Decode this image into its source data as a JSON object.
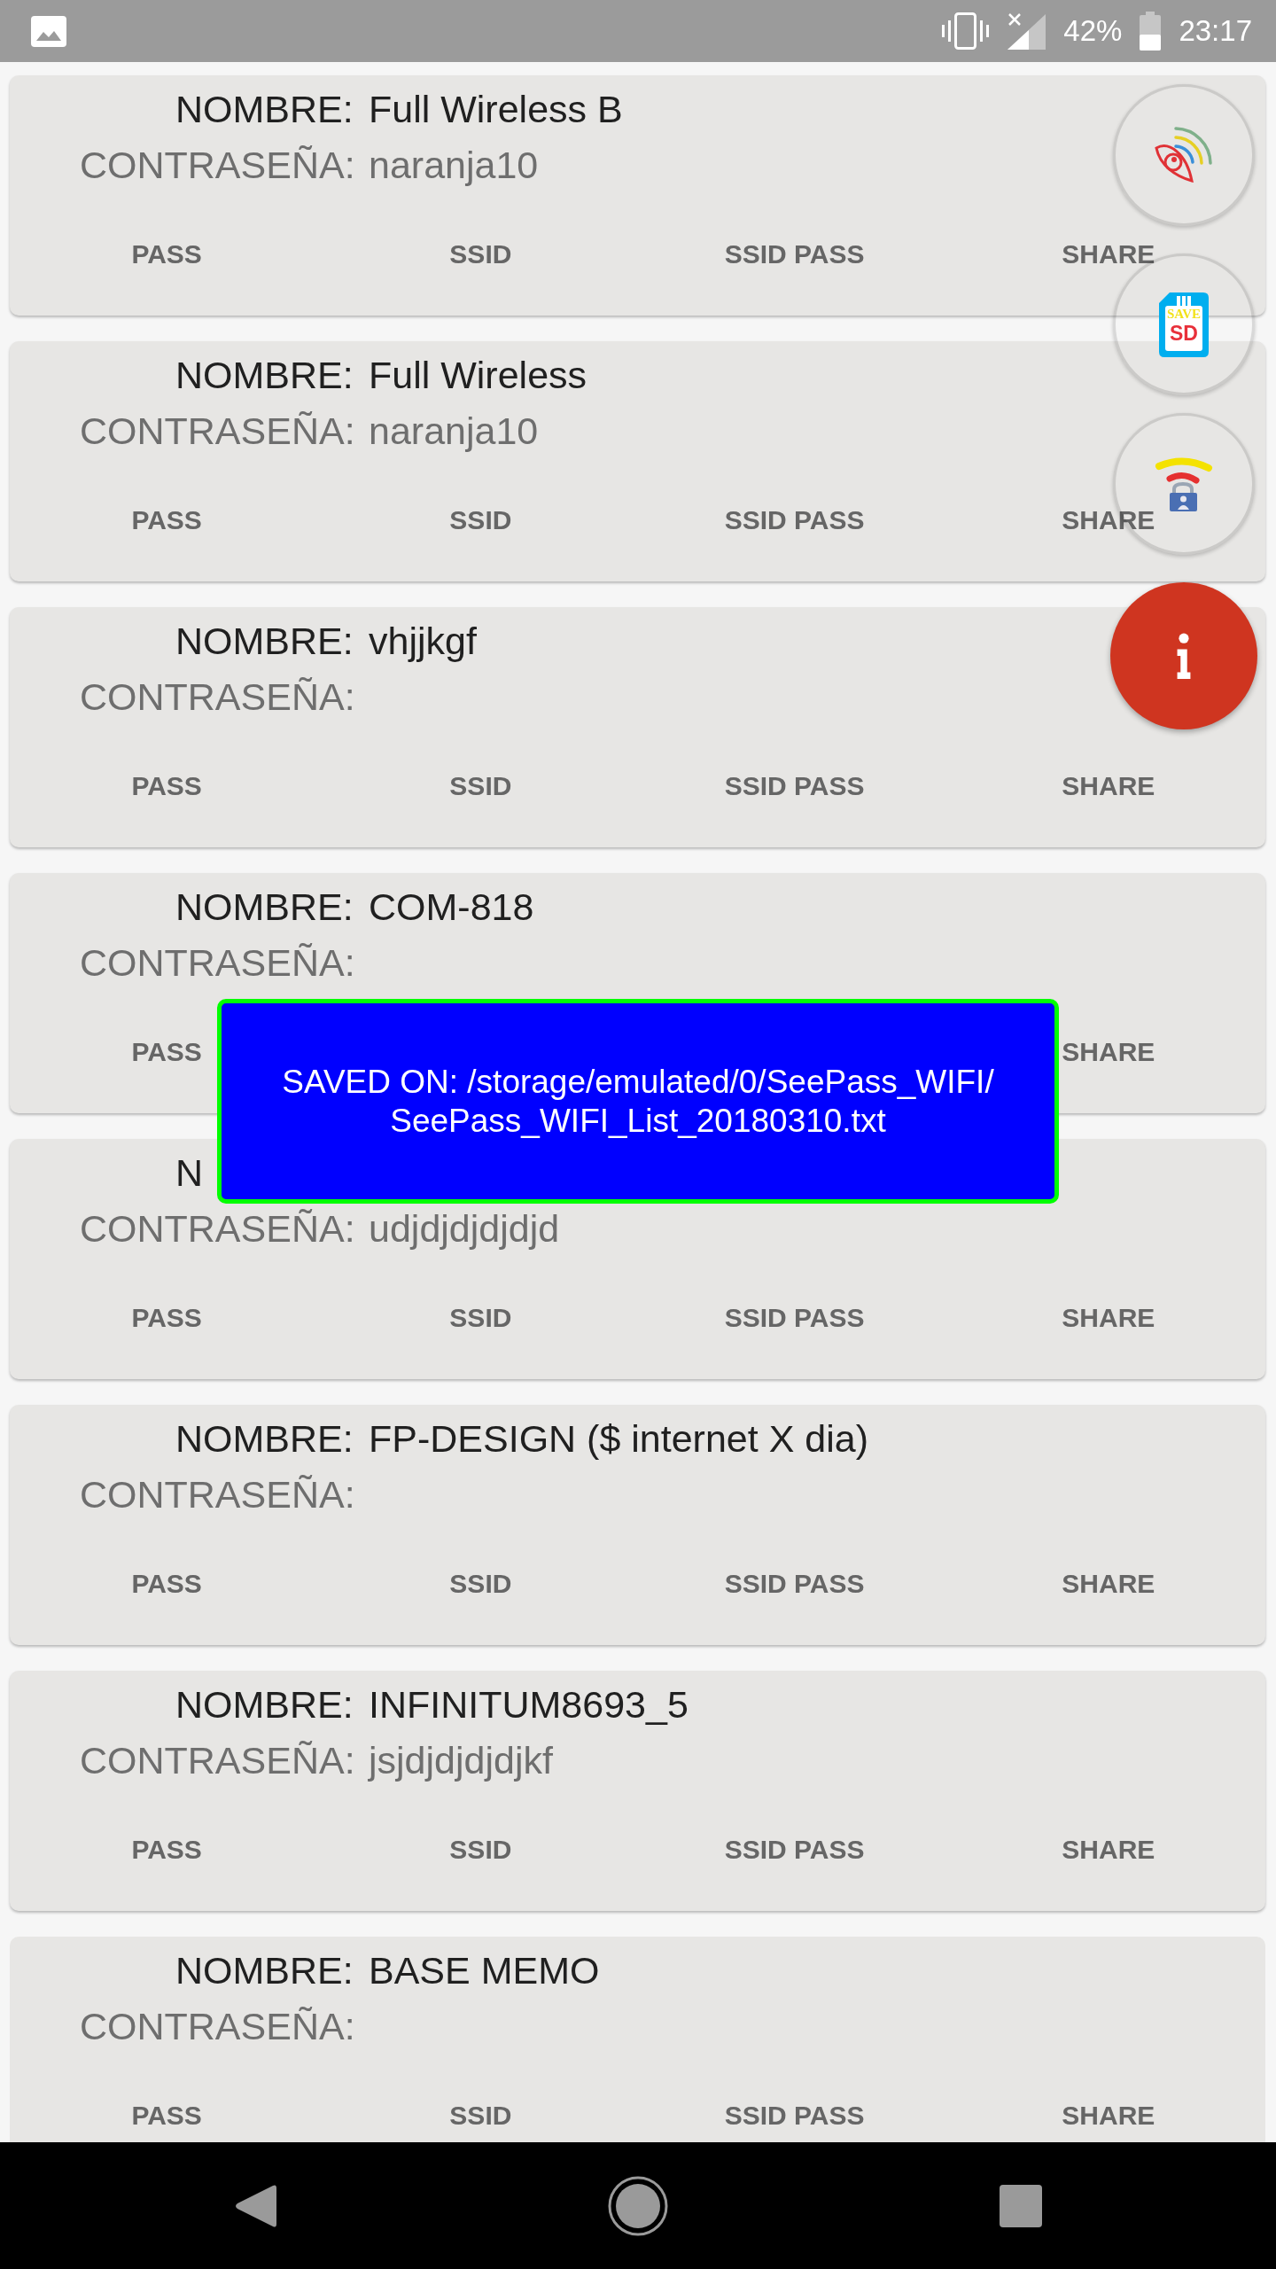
{
  "status_bar": {
    "battery": "42%",
    "time": "23:17"
  },
  "networks": [
    {
      "name_label": "NOMBRE:",
      "name": "Full Wireless B",
      "password_label": "CONTRASEÑA:",
      "password": "naranja10",
      "actions": [
        "PASS",
        "SSID",
        "SSID PASS",
        "SHARE"
      ]
    },
    {
      "name_label": "NOMBRE:",
      "name": "Full Wireless",
      "password_label": "CONTRASEÑA:",
      "password": "naranja10",
      "actions": [
        "PASS",
        "SSID",
        "SSID PASS",
        "SHARE"
      ]
    },
    {
      "name_label": "NOMBRE:",
      "name": "vhjjkgf",
      "password_label": "CONTRASEÑA:",
      "actions": [
        "PASS",
        "SSID",
        "SSID PASS",
        "SHARE"
      ]
    },
    {
      "name_label": "NOMBRE:",
      "name": "COM-818",
      "password_label": "CONTRASEÑA:",
      "actions": [
        "PASS",
        "SHARE"
      ]
    },
    {
      "name_label": "N",
      "password_label": "CONTRASEÑA:",
      "password": "udjdjdjdjdjd",
      "actions": [
        "PASS",
        "SSID",
        "SSID PASS",
        "SHARE"
      ]
    },
    {
      "name_label": "NOMBRE:",
      "name": "FP-DESIGN ($ internet X dia)",
      "password_label": "CONTRASEÑA:",
      "actions": [
        "PASS",
        "SSID",
        "SSID PASS",
        "SHARE"
      ]
    },
    {
      "name_label": "NOMBRE:",
      "name": "INFINITUM8693_5",
      "password_label": "CONTRASEÑA:",
      "password": "jsjdjdjdjdjkf",
      "actions": [
        "PASS",
        "SSID",
        "SSID PASS",
        "SHARE"
      ]
    },
    {
      "name_label": "NOMBRE:",
      "name": "BASE MEMO",
      "password_label": "CONTRASEÑA:",
      "actions": [
        "PASS",
        "SSID",
        "SSID PASS",
        "SHARE"
      ]
    }
  ],
  "floating_buttons": {
    "sd_card_texts": [
      "SAVE",
      "SD"
    ]
  },
  "toast": {
    "lines": [
      "SAVED ON: /storage/emulated/0/SeePass_WIFI/",
      "SeePass_WIFI_List_20180310.txt"
    ]
  }
}
